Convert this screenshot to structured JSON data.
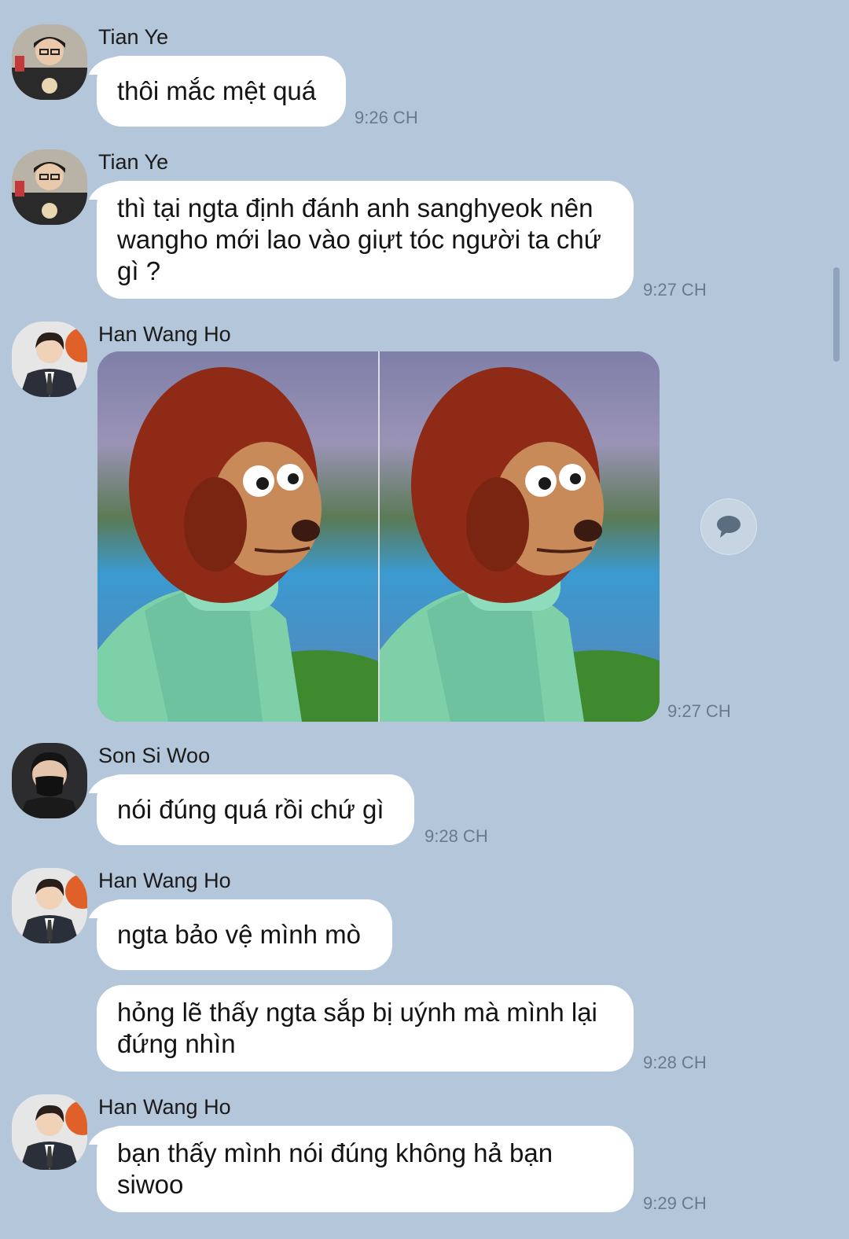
{
  "chat": {
    "messages": [
      {
        "sender": "Tian Ye",
        "text": "thôi mắc mệt quá",
        "time": "9:26 CH"
      },
      {
        "sender": "Tian Ye",
        "text": "thì tại ngta định đánh anh sanghyeok nên wangho mới lao vào giựt tóc người ta chứ gì ?",
        "time": "9:27 CH"
      },
      {
        "sender": "Han Wang Ho",
        "image": "puppet-meme-image",
        "time": "9:27 CH"
      },
      {
        "sender": "Son Si Woo",
        "text": "nói đúng quá rồi chứ gì",
        "time": "9:28 CH"
      },
      {
        "sender": "Han Wang Ho",
        "text": "ngta bảo vệ mình mò"
      },
      {
        "text": "hỏng lẽ thấy ngta sắp bị uýnh mà mình lại đứng nhìn",
        "time": "9:28 CH"
      },
      {
        "sender": "Han Wang Ho",
        "text": "bạn thấy mình nói đúng không hả bạn siwoo",
        "time": "9:29 CH"
      }
    ]
  },
  "colors": {
    "background": "#b3c6da",
    "bubble": "#ffffff",
    "time": "#6b7a8a"
  },
  "icons": {
    "reply": "speech-bubble-icon"
  }
}
